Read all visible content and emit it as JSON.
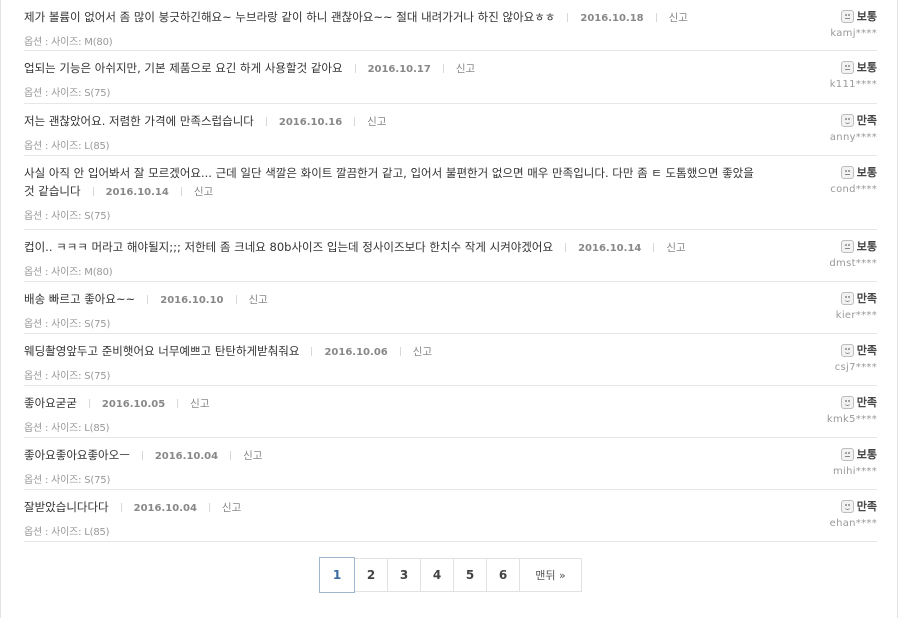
{
  "reviews": [
    {
      "comment": "제가 볼륨이 없어서 좀 많이 붕긋하긴해요~ 누브라랑 같이 하니 괜찮아요~~ 절대 내려가거나 하진 않아요ㅎㅎ",
      "date": "2016.10.18",
      "report": "신고",
      "option": "옵션 : 사이즈: M(80)",
      "rating": "보통",
      "rating_icon": "neutral-face-icon",
      "user": "kamj****"
    },
    {
      "comment": "업되는 기능은 아쉬지만, 기본 제품으로 요긴 하게 사용할것 같아요",
      "date": "2016.10.17",
      "report": "신고",
      "option": "옵션 : 사이즈: S(75)",
      "rating": "보통",
      "rating_icon": "neutral-face-icon",
      "user": "k111****"
    },
    {
      "comment": "저는 괜찮았어요. 저렴한 가격에 만족스럽습니다",
      "date": "2016.10.16",
      "report": "신고",
      "option": "옵션 : 사이즈: L(85)",
      "rating": "만족",
      "rating_icon": "happy-face-icon",
      "user": "anny****"
    },
    {
      "comment": "사실 아직 안 입어봐서 잘 모르겠어요... 근데 일단 색깔은 화이트 깔끔한거 같고, 입어서 불편한거 없으면 매우 만족입니다. 다만 좀 ㅌ 도톰했으면 좋았을 것 같습니다",
      "date": "2016.10.14",
      "report": "신고",
      "option": "옵션 : 사이즈: S(75)",
      "rating": "보통",
      "rating_icon": "neutral-face-icon",
      "user": "cond****"
    },
    {
      "comment": "컵이.. ㅋㅋㅋ 머라고 해야될지;;; 저한테 좀 크네요 80b사이즈 입는데 정사이즈보다 한치수 작게 시켜야겠어요",
      "date": "2016.10.14",
      "report": "신고",
      "option": "옵션 : 사이즈: M(80)",
      "rating": "보통",
      "rating_icon": "neutral-face-icon",
      "user": "dmst****"
    },
    {
      "comment": "배송 빠르고 좋아요~~",
      "date": "2016.10.10",
      "report": "신고",
      "option": "옵션 : 사이즈: S(75)",
      "rating": "만족",
      "rating_icon": "happy-face-icon",
      "user": "kier****"
    },
    {
      "comment": "웨딩촬영앞두고 준비햇어요 너무예쁘고 탄탄하게받춰줘요",
      "date": "2016.10.06",
      "report": "신고",
      "option": "옵션 : 사이즈: S(75)",
      "rating": "만족",
      "rating_icon": "happy-face-icon",
      "user": "csj7****"
    },
    {
      "comment": "좋아요굳굳",
      "date": "2016.10.05",
      "report": "신고",
      "option": "옵션 : 사이즈: L(85)",
      "rating": "만족",
      "rating_icon": "happy-face-icon",
      "user": "kmk5****"
    },
    {
      "comment": "좋아요좋아요좋아오ㅡ",
      "date": "2016.10.04",
      "report": "신고",
      "option": "옵션 : 사이즈: S(75)",
      "rating": "보통",
      "rating_icon": "neutral-face-icon",
      "user": "mihi****"
    },
    {
      "comment": "잘받았습니다다다",
      "date": "2016.10.04",
      "report": "신고",
      "option": "옵션 : 사이즈: L(85)",
      "rating": "만족",
      "rating_icon": "happy-face-icon",
      "user": "ehan****"
    }
  ],
  "pagination": {
    "pages": [
      "1",
      "2",
      "3",
      "4",
      "5",
      "6"
    ],
    "current": "1",
    "last_label": "맨뒤 »"
  },
  "colors": {
    "accent": "#3b6aa0",
    "border": "#e6e6e6"
  }
}
